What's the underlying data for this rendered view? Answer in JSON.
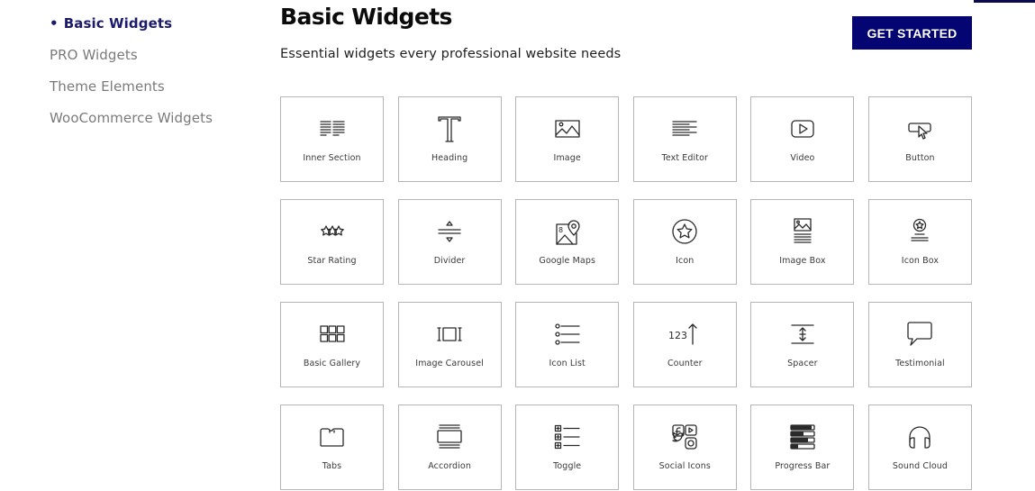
{
  "sidebar": {
    "items": [
      {
        "label": "Basic Widgets",
        "active": true,
        "bullet": "•"
      },
      {
        "label": "PRO Widgets",
        "active": false
      },
      {
        "label": "Theme Elements",
        "active": false
      },
      {
        "label": "WooCommerce Widgets",
        "active": false
      }
    ]
  },
  "header": {
    "title": "Basic Widgets",
    "subtitle": "Essential widgets every professional website needs",
    "cta_label": "GET STARTED"
  },
  "colors": {
    "accent": "#050473",
    "active_nav": "#1b1a6b",
    "inactive_nav": "#7a7a7a",
    "card_border": "#b5b5b5"
  },
  "widgets": [
    {
      "label": "Inner Section",
      "icon": "inner-section-icon"
    },
    {
      "label": "Heading",
      "icon": "heading-icon"
    },
    {
      "label": "Image",
      "icon": "image-icon"
    },
    {
      "label": "Text Editor",
      "icon": "text-editor-icon"
    },
    {
      "label": "Video",
      "icon": "video-icon"
    },
    {
      "label": "Button",
      "icon": "button-icon"
    },
    {
      "label": "Star Rating",
      "icon": "star-rating-icon"
    },
    {
      "label": "Divider",
      "icon": "divider-icon"
    },
    {
      "label": "Google Maps",
      "icon": "google-maps-icon"
    },
    {
      "label": "Icon",
      "icon": "star-circle-icon"
    },
    {
      "label": "Image Box",
      "icon": "image-box-icon"
    },
    {
      "label": "Icon Box",
      "icon": "icon-box-icon"
    },
    {
      "label": "Basic Gallery",
      "icon": "gallery-grid-icon"
    },
    {
      "label": "Image Carousel",
      "icon": "image-carousel-icon"
    },
    {
      "label": "Icon List",
      "icon": "icon-list-icon"
    },
    {
      "label": "Counter",
      "icon": "counter-icon",
      "icon_text": "123"
    },
    {
      "label": "Spacer",
      "icon": "spacer-icon"
    },
    {
      "label": "Testimonial",
      "icon": "speech-bubble-icon"
    },
    {
      "label": "Tabs",
      "icon": "tabs-folder-icon"
    },
    {
      "label": "Accordion",
      "icon": "accordion-icon"
    },
    {
      "label": "Toggle",
      "icon": "toggle-list-icon"
    },
    {
      "label": "Social Icons",
      "icon": "social-icons-icon"
    },
    {
      "label": "Progress Bar",
      "icon": "progress-bars-icon"
    },
    {
      "label": "Sound Cloud",
      "icon": "headphones-icon"
    }
  ]
}
